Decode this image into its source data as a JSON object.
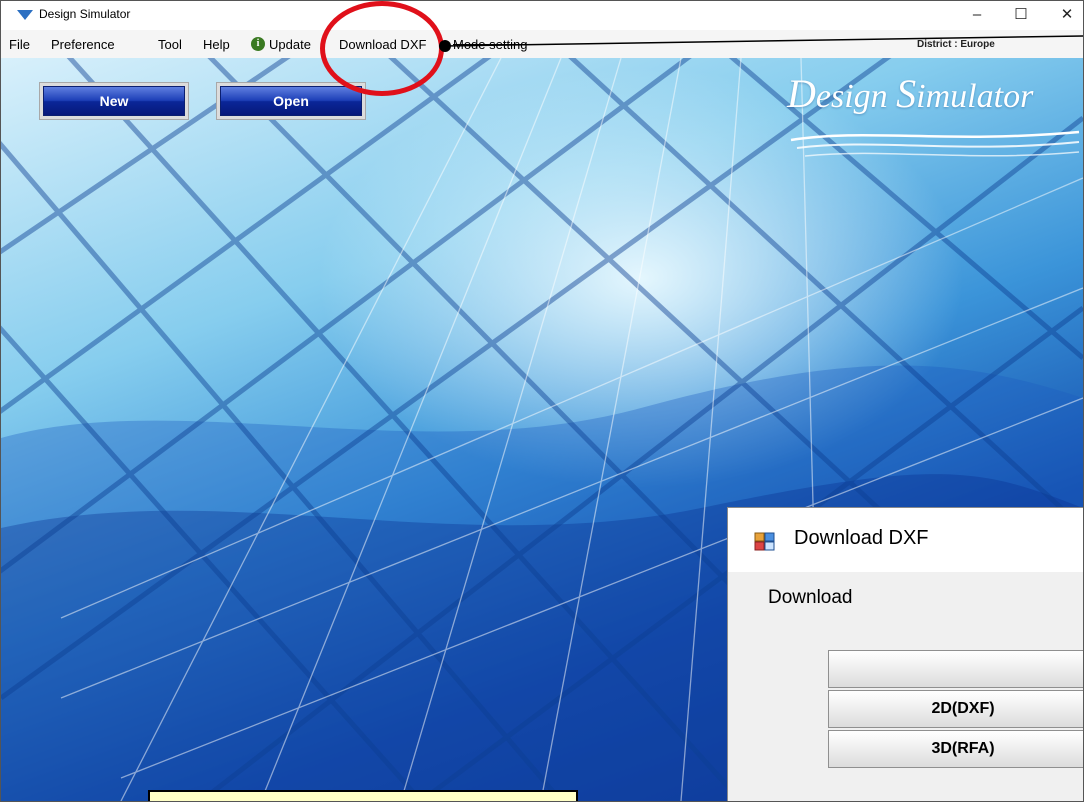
{
  "window": {
    "title": "Design Simulator",
    "controls": [
      "–",
      "☐",
      "✕"
    ]
  },
  "menu": {
    "items": [
      "File",
      "Preference",
      "Tool",
      "Help",
      "Update",
      "Download DXF",
      "Mode setting"
    ],
    "update_icon": "info-icon",
    "district": "District : Europe"
  },
  "buttons": {
    "new": "New",
    "open": "Open"
  },
  "logo": {
    "first": "D",
    "first_rest": "esign ",
    "second": "S",
    "second_rest": "imulator"
  },
  "dialog": {
    "title": "Download DXF",
    "section_label": "Download",
    "rows": [
      "",
      "2D(DXF)",
      "3D(RFA)"
    ]
  },
  "colors": {
    "annotation": "#e0101a",
    "button": "#1d3fb7",
    "callout": "#ffffc6"
  }
}
